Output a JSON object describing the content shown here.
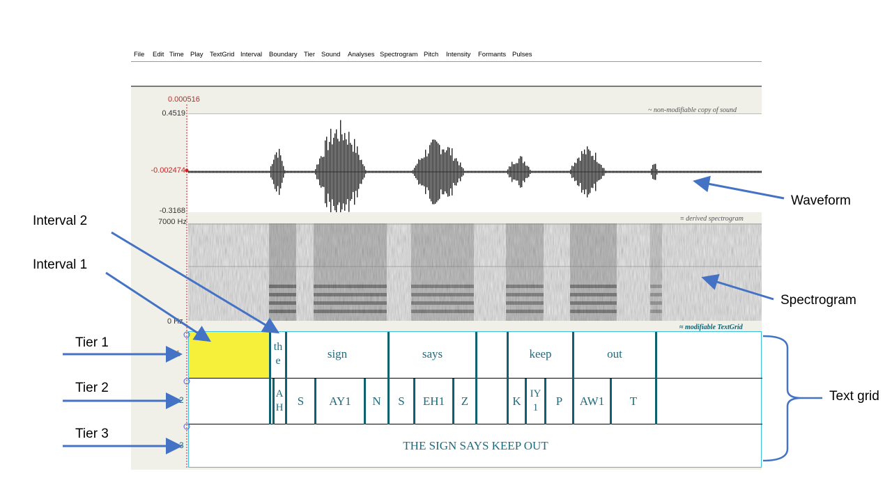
{
  "menu": [
    "File",
    "Edit",
    "Time",
    "Play",
    "TextGrid",
    "Interval",
    "Boundary",
    "Tier",
    "Sound",
    "Analyses",
    "Spectrogram",
    "Pitch",
    "Intensity",
    "Formants",
    "Pulses"
  ],
  "cursor_time": "0.000516",
  "waveform": {
    "max": "0.4519",
    "center": "-0.002474",
    "min": "-0.3168",
    "caption": "~ non-modifiable copy of sound"
  },
  "spectrogram": {
    "top": "7000 Hz",
    "bottom": "0 Hz",
    "caption": "derived spectrogram"
  },
  "textgrid": {
    "caption": "modifiable TextGrid",
    "tier_numbers": [
      "1",
      "2",
      "3"
    ],
    "tier1": [
      "th e",
      "sign",
      "says",
      "keep",
      "out"
    ],
    "tier2": [
      "A H",
      "S",
      "AY1",
      "N",
      "S",
      "EH1",
      "Z",
      "K",
      "IY 1",
      "P",
      "AW1",
      "T"
    ],
    "tier3": "THE SIGN SAYS KEEP OUT"
  },
  "annotations": {
    "waveform": "Waveform",
    "spectrogram": "Spectrogram",
    "interval2": "Interval 2",
    "interval1": "Interval 1",
    "tier1": "Tier 1",
    "tier2": "Tier 2",
    "tier3": "Tier 3",
    "textgrid": "Text grid"
  },
  "colors": {
    "arrow": "#4472c4",
    "selection": "#f7f03a",
    "grid": "#0e6170",
    "cursor": "#cc2222"
  }
}
